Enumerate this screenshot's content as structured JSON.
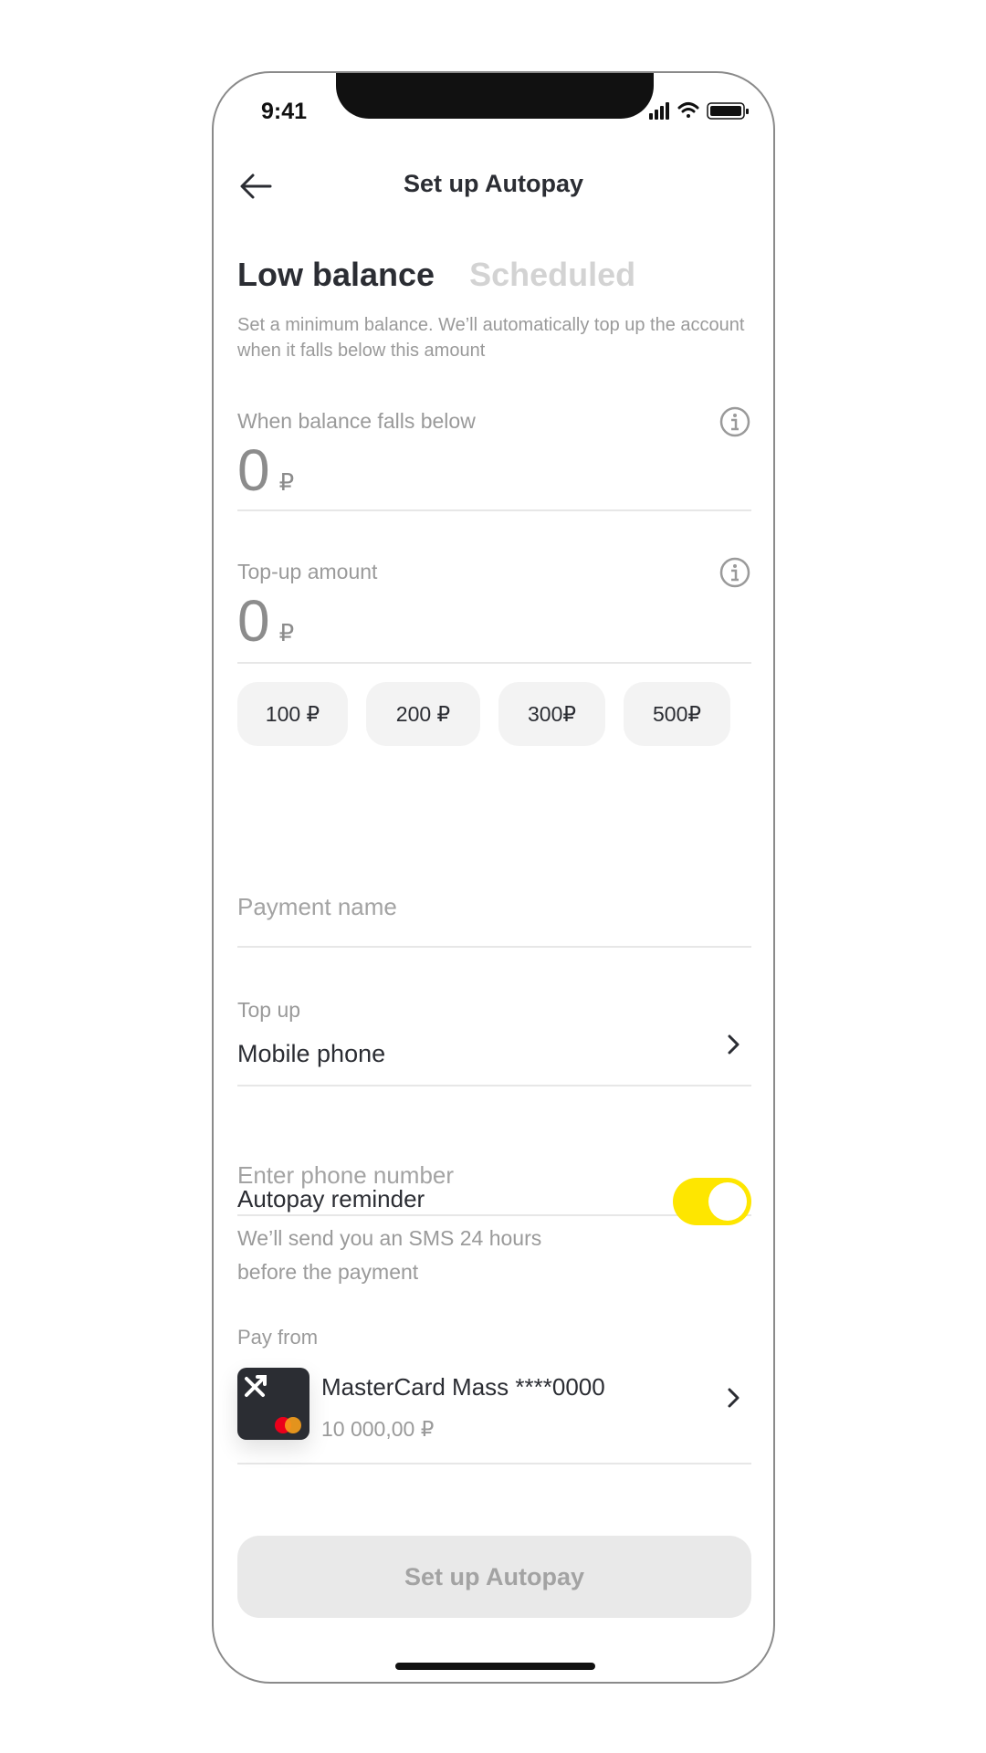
{
  "status_bar": {
    "time": "9:41"
  },
  "header": {
    "title": "Set up Autopay"
  },
  "tabs": [
    {
      "label": "Low balance",
      "active": true
    },
    {
      "label": "Scheduled",
      "active": false
    }
  ],
  "description": "Set a minimum balance. We’ll automatically top up the account when it falls below this amount",
  "threshold": {
    "label": "When balance falls below",
    "value": "0",
    "currency": "₽"
  },
  "topup_amount": {
    "label": "Top-up amount",
    "value": "0",
    "currency": "₽"
  },
  "quick_amounts": [
    "100 ₽",
    "200 ₽",
    "300₽",
    "500₽"
  ],
  "payment_name": {
    "placeholder": "Payment name"
  },
  "topup_target": {
    "label": "Top up",
    "value": "Mobile phone"
  },
  "phone": {
    "placeholder": "Enter phone number"
  },
  "reminder": {
    "title": "Autopay reminder",
    "description": "We’ll send you an SMS 24 hours before the payment",
    "enabled": true
  },
  "pay_from": {
    "label": "Pay from",
    "card_name": "MasterCard Mass ****0000",
    "card_balance": "10 000,00 ₽"
  },
  "submit": {
    "label": "Set up Autopay"
  },
  "colors": {
    "accent": "#fee600",
    "text": "#2b2d33",
    "muted": "#9a9a9a"
  }
}
